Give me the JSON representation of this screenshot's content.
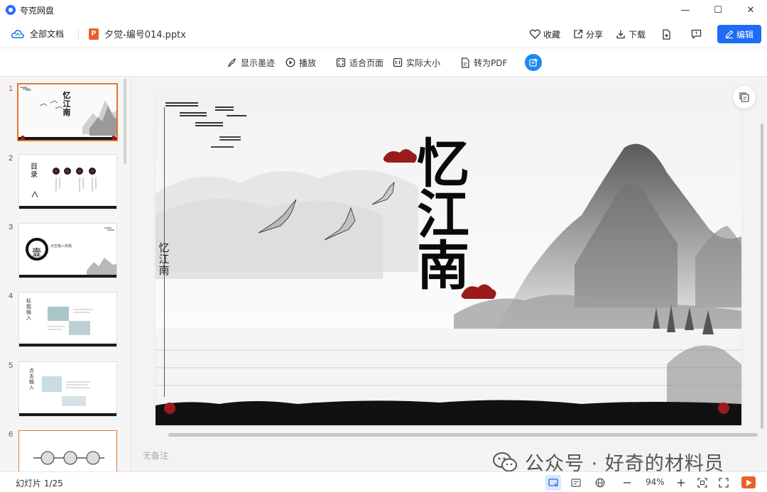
{
  "window": {
    "app_title": "夸克网盘",
    "controls": [
      "—",
      "☐",
      "✕"
    ]
  },
  "header": {
    "all_docs": "全部文档",
    "file_name": "夕觉-编号014.pptx",
    "file_type_letter": "P",
    "actions": {
      "favorite": "收藏",
      "share": "分享",
      "download": "下载"
    },
    "edit": "编辑"
  },
  "toolbar": {
    "show_ink": "显示墨迹",
    "play": "播放",
    "fit_page": "适合页面",
    "actual_size": "实际大小",
    "to_pdf": "转为PDF"
  },
  "thumbnails": {
    "items": [
      {
        "num": "1",
        "active": true
      },
      {
        "num": "2",
        "active": false
      },
      {
        "num": "3",
        "active": false
      },
      {
        "num": "4",
        "active": false
      },
      {
        "num": "5",
        "active": false
      },
      {
        "num": "6",
        "active": false
      }
    ],
    "texts": {
      "s1_title": "忆江南",
      "s2_title": "目录",
      "s3_mark": "壹",
      "s3_caption": "点击输入标题",
      "s4_title": "标题输入",
      "s5_title": "点击输入"
    }
  },
  "slide": {
    "title": "忆江南",
    "subtitle": "忆江南"
  },
  "notes_placeholder": "无备注",
  "watermark": "公众号 · 好奇的材料员",
  "status": {
    "slide_counter": "幻灯片 1/25",
    "zoom": "94%"
  },
  "colors": {
    "accent": "#1e6cf5",
    "ppt_orange": "#e8612c",
    "active_border": "#e0782f",
    "seal_red": "#9b1a1a"
  }
}
